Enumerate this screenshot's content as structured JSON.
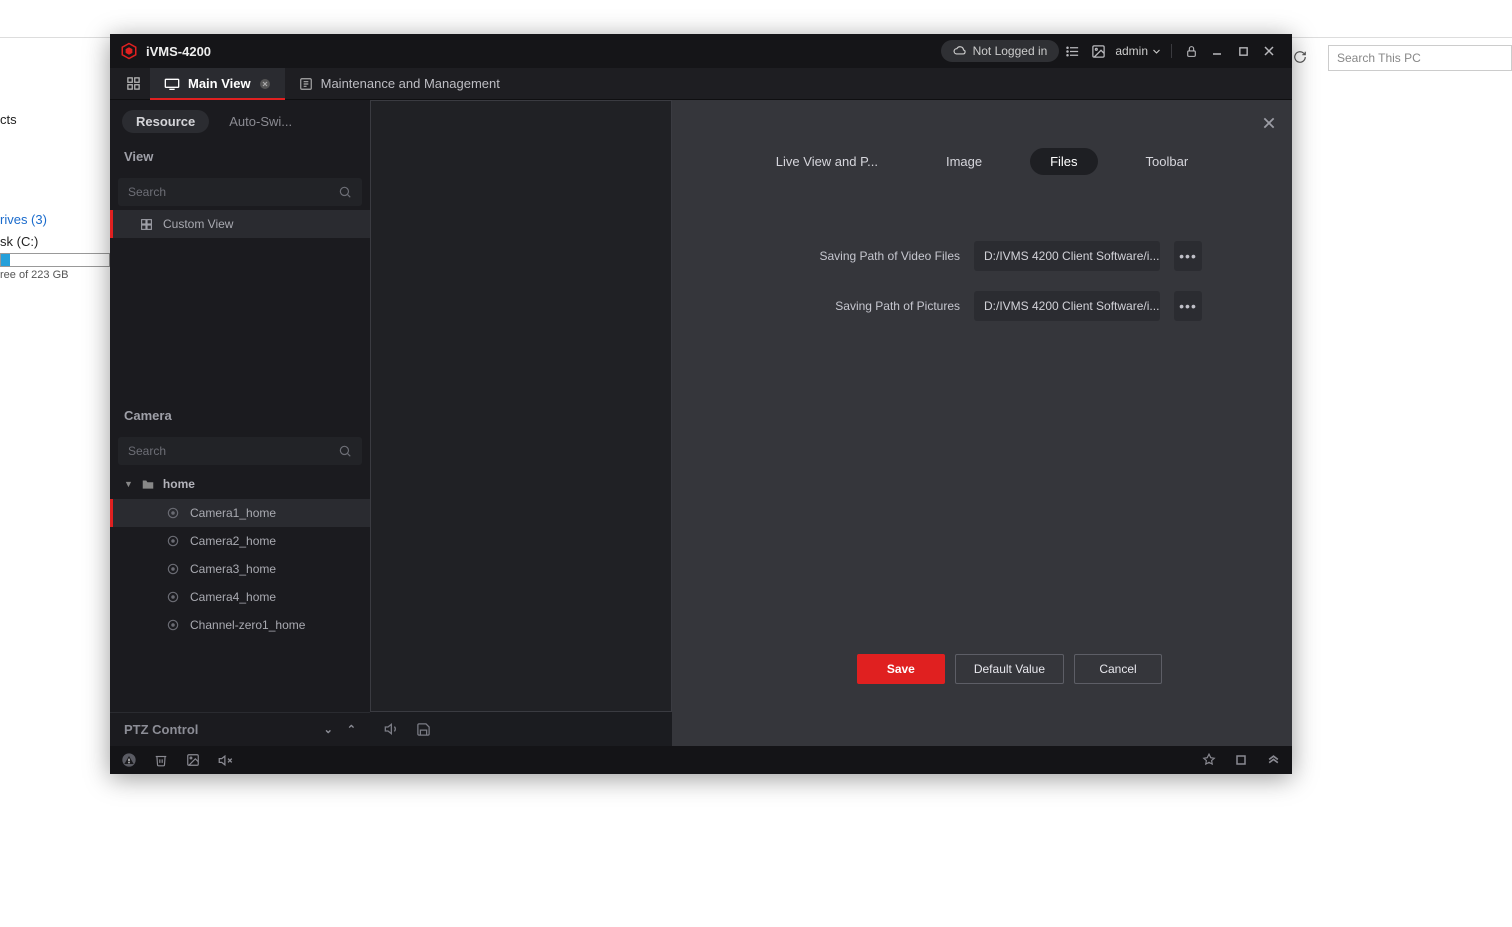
{
  "host": {
    "search_placeholder": "Search This PC",
    "side_label": "cts",
    "drives_header": "rives (3)",
    "drive_label": "sk (C:)",
    "drive_free": "ree of 223 GB"
  },
  "app": {
    "name": "iVMS-4200",
    "login_status": "Not Logged in",
    "user": "admin"
  },
  "tabs": {
    "main_view": "Main View",
    "maintenance": "Maintenance and Management"
  },
  "sidebar": {
    "tab_resource": "Resource",
    "tab_auto": "Auto-Swi...",
    "view_header": "View",
    "search_placeholder": "Search",
    "custom_view": "Custom View",
    "camera_header": "Camera",
    "group": "home",
    "cameras": [
      "Camera1_home",
      "Camera2_home",
      "Camera3_home",
      "Camera4_home",
      "Channel-zero1_home"
    ],
    "ptz": "PTZ Control"
  },
  "dialog": {
    "tabs": {
      "live": "Live View and P...",
      "image": "Image",
      "files": "Files",
      "toolbar": "Toolbar"
    },
    "row1_label": "Saving Path of Video Files",
    "row1_value": "D:/IVMS 4200 Client Software/i...",
    "row2_label": "Saving Path of Pictures",
    "row2_value": "D:/IVMS 4200 Client Software/i...",
    "save": "Save",
    "default": "Default Value",
    "cancel": "Cancel"
  }
}
